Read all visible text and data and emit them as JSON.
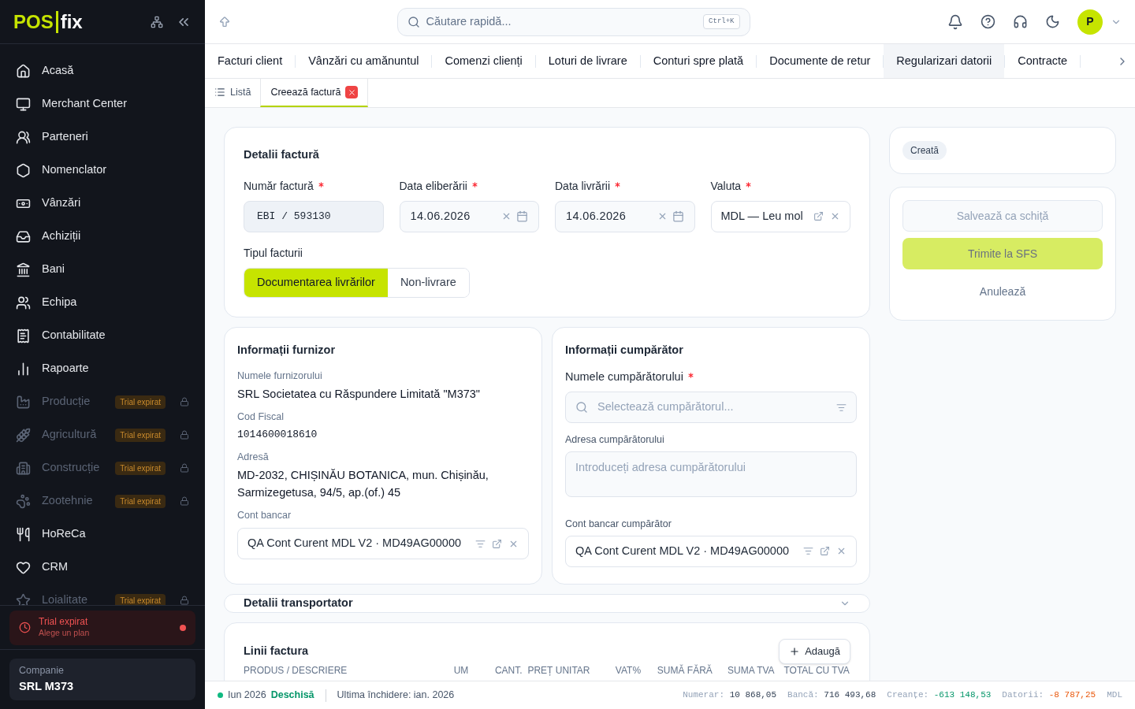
{
  "sidebar": {
    "logo": {
      "left": "POS",
      "right": "fix"
    },
    "items": [
      {
        "label": "Acasă",
        "locked": false
      },
      {
        "label": "Merchant Center",
        "locked": false
      },
      {
        "label": "Parteneri",
        "locked": false
      },
      {
        "label": "Nomenclator",
        "locked": false
      },
      {
        "label": "Vânzări",
        "locked": false
      },
      {
        "label": "Achiziții",
        "locked": false
      },
      {
        "label": "Bani",
        "locked": false
      },
      {
        "label": "Echipa",
        "locked": false
      },
      {
        "label": "Contabilitate",
        "locked": false
      },
      {
        "label": "Rapoarte",
        "locked": false
      },
      {
        "label": "Producție",
        "locked": true,
        "badge": "Trial expirat"
      },
      {
        "label": "Agricultură",
        "locked": true,
        "badge": "Trial expirat"
      },
      {
        "label": "Construcție",
        "locked": true,
        "badge": "Trial expirat"
      },
      {
        "label": "Zootehnie",
        "locked": true,
        "badge": "Trial expirat"
      },
      {
        "label": "HoReCa",
        "locked": false
      },
      {
        "label": "CRM",
        "locked": false
      },
      {
        "label": "Loialitate",
        "locked": true,
        "badge": "Trial expirat"
      }
    ],
    "trial": {
      "title": "Trial expirat",
      "subtitle": "Alege un plan"
    },
    "company": {
      "label": "Companie",
      "name": "SRL M373"
    }
  },
  "header": {
    "search": {
      "placeholder": "Căutare rapidă...",
      "shortcut": "Ctrl+K"
    },
    "avatar": "P"
  },
  "tabs": [
    {
      "label": "Facturi client",
      "selected": false
    },
    {
      "label": "Vânzări cu amănuntul",
      "selected": false
    },
    {
      "label": "Comenzi clienți",
      "selected": false
    },
    {
      "label": "Loturi de livrare",
      "selected": false
    },
    {
      "label": "Conturi spre plată",
      "selected": false
    },
    {
      "label": "Documente de retur",
      "selected": false
    },
    {
      "label": "Regularizari datorii",
      "selected": true
    },
    {
      "label": "Contracte",
      "selected": false
    }
  ],
  "subtabs": [
    {
      "label": "Listă",
      "selected": false,
      "closable": false
    },
    {
      "label": "Creează factură",
      "selected": true,
      "closable": true
    }
  ],
  "invoice_details": {
    "title": "Detalii factură",
    "fields": [
      {
        "kind": "number",
        "label": "Număr factură",
        "required": true,
        "value": "EBI / 593130"
      },
      {
        "kind": "date",
        "label": "Data eliberării",
        "required": true,
        "value": "14.06.2026"
      },
      {
        "kind": "date",
        "label": "Data livrării",
        "required": true,
        "value": "14.06.2026"
      },
      {
        "kind": "select",
        "label": "Valuta",
        "required": true,
        "value": "MDL — Leu mol"
      }
    ],
    "type": {
      "label": "Tipul facturii",
      "options": [
        {
          "label": "Documentarea livrărilor",
          "selected": true
        },
        {
          "label": "Non-livrare",
          "selected": false
        }
      ]
    }
  },
  "supplier": {
    "title": "Informații furnizor",
    "fields": [
      {
        "kind": "text",
        "label": "Numele furnizorului",
        "value": "SRL Societatea cu Răspundere Limitată \"M373\""
      },
      {
        "kind": "mono",
        "label": "Cod Fiscal",
        "value": "1014600018610"
      },
      {
        "kind": "text",
        "label": "Adresă",
        "value": "MD-2032, CHIȘINĂU BOTANICA, mun. Chișinău, Sarmizegetusa, 94/5, ap.(of.) 45"
      },
      {
        "kind": "account",
        "label": "Cont bancar",
        "value": "QA Cont Curent MDL V2 · MD49AG00000"
      }
    ]
  },
  "buyer": {
    "title": "Informații cumpărător",
    "name": {
      "label": "Numele cumpărătorului",
      "required": true,
      "placeholder": "Selectează cumpărătorul..."
    },
    "address": {
      "label": "Adresa cumpărătorului",
      "placeholder": "Introduceți adresa cumpărătorului"
    },
    "account": {
      "label": "Cont bancar cumpărător",
      "value": "QA Cont Curent MDL V2 · MD49AG00000"
    }
  },
  "carrier": {
    "title": "Detalii transportator",
    "expanded": false
  },
  "lines": {
    "title": "Linii factura",
    "add_button": "Adaugă",
    "columns": [
      "PRODUS / DESCRIERE",
      "UM",
      "CANT.",
      "PREȚ UNITAR",
      "VAT%",
      "SUMĂ FĂRĂ",
      "SUMA TVA",
      "TOTAL CU TVA"
    ]
  },
  "status": {
    "label": "Creată"
  },
  "actions": [
    {
      "label": "Salvează ca schiță",
      "kind": "secondary"
    },
    {
      "label": "Trimite la SFS",
      "kind": "primary"
    },
    {
      "label": "Anulează",
      "kind": "ghost"
    }
  ],
  "status_bar": {
    "period": "Iun 2026",
    "state": "Deschisă",
    "last_close": "Ultima închidere: ian. 2026",
    "stats": [
      {
        "label": "Numerar:",
        "value": "10 868,05",
        "color": "#334155"
      },
      {
        "label": "Bancă:",
        "value": "716 493,68",
        "color": "#334155"
      },
      {
        "label": "Creanțe:",
        "value": "-613 148,53",
        "color": "#059669"
      },
      {
        "label": "Datorii:",
        "value": "-8 787,25",
        "color": "#ea580c"
      }
    ],
    "currency": "MDL"
  }
}
